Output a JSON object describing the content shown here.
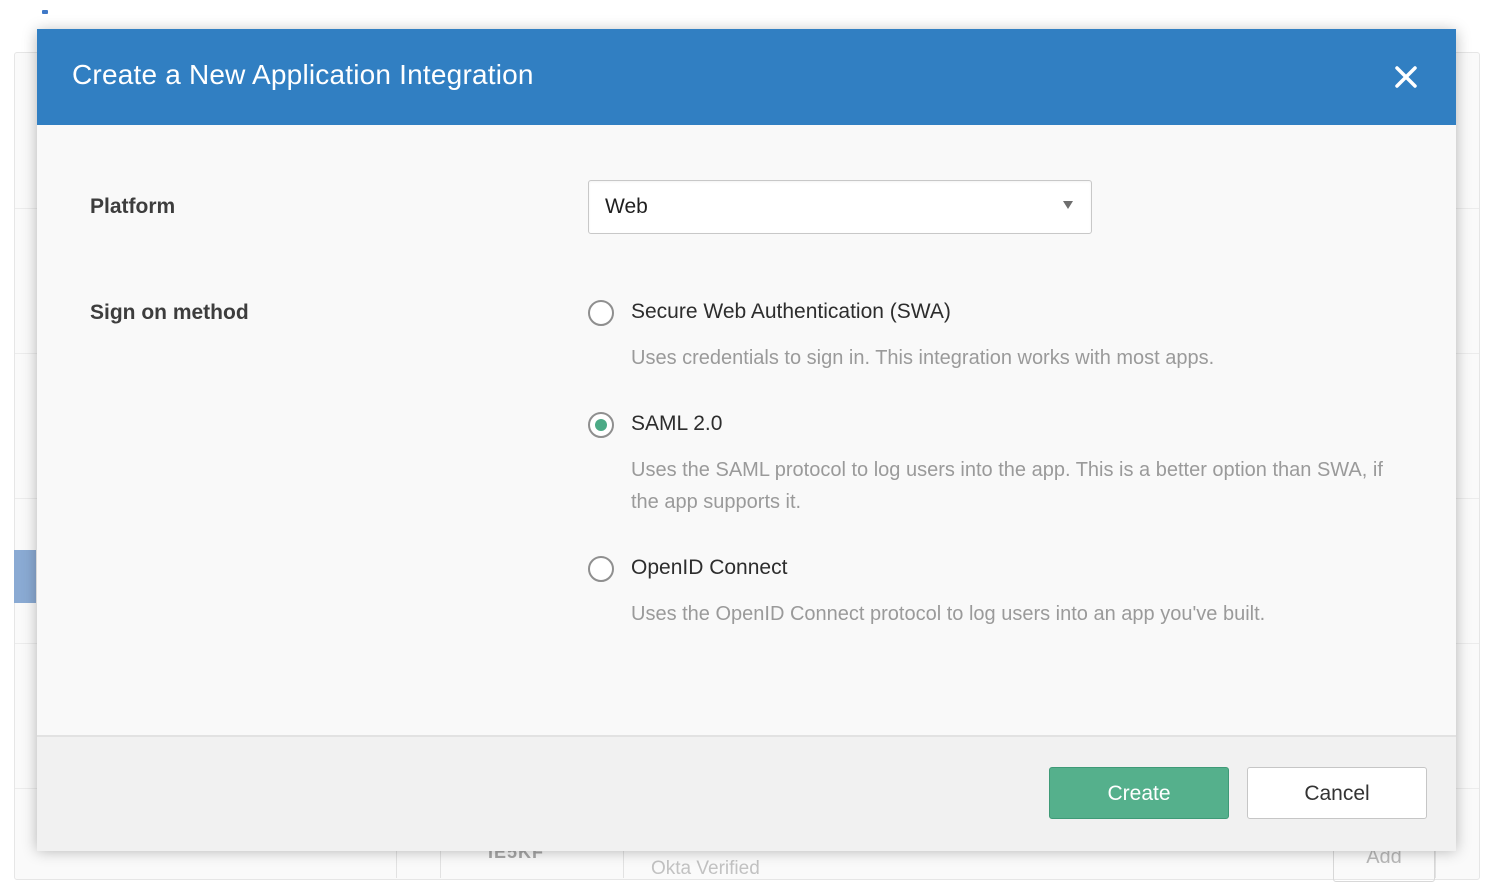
{
  "modal": {
    "title": "Create a New Application Integration",
    "close_icon": "close-icon"
  },
  "platform": {
    "label": "Platform",
    "selected": "Web"
  },
  "sign_on": {
    "label": "Sign on method",
    "selected_option": "SAML 2.0",
    "options": [
      {
        "label": "Secure Web Authentication (SWA)",
        "description": "Uses credentials to sign in. This integration works with most apps.",
        "checked": false
      },
      {
        "label": "SAML 2.0",
        "description": "Uses the SAML protocol to log users into the app. This is a better option than SWA, if the app supports it.",
        "checked": true
      },
      {
        "label": "OpenID Connect",
        "description": "Uses the OpenID Connect protocol to log users into an app you've built.",
        "checked": false
      }
    ]
  },
  "footer": {
    "create_label": "Create",
    "cancel_label": "Cancel"
  },
  "background": {
    "app_sub_text": "Okta Verified",
    "add_label": "Add"
  },
  "colors": {
    "header": "#317fc2",
    "create_button": "#55b08c",
    "radio_selected": "#4caa86"
  }
}
